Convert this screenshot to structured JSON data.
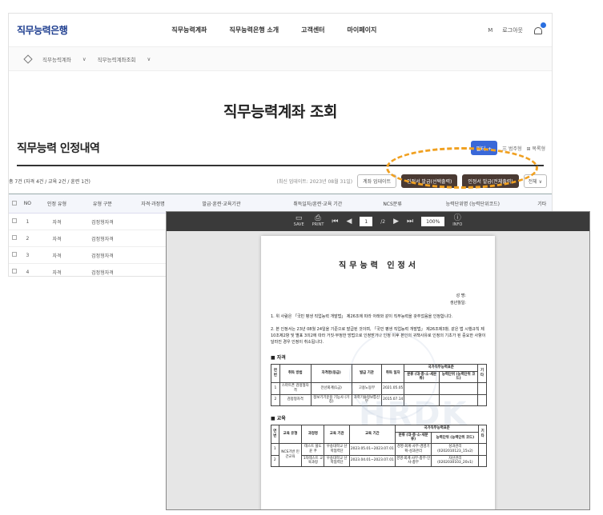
{
  "site": {
    "logo": "직무능력은행",
    "menu": [
      "직무능력계좌",
      "직무능력은행 소개",
      "고객센터",
      "마이페이지"
    ],
    "util": {
      "login": "로그아웃",
      "user_mark": "M"
    },
    "breadcrumb": [
      "직무능력계좌",
      "직무능력계좌조회"
    ],
    "page_title": "직무능력계좌 조회",
    "section_title": "직무능력 인정내역",
    "filter_button": "필터 +",
    "view_options": [
      "三 범주형",
      "⊞ 목록형"
    ],
    "total_text": "총 7건 (자격 4건 / 교육 2건 / 훈련 1건)",
    "update_text": "(최신 업데이트: 2023년 08월 31일)",
    "buttons": {
      "update": "계좌 업데이트",
      "issue_selected": "인정서 발급(선택출력)",
      "issue_all": "인정서 발급(전체출력)",
      "all_select": "전체 ∨"
    },
    "table": {
      "headers": [
        "",
        "NO",
        "인정 유형",
        "유형 구분",
        "자격·과정명",
        "발급·훈련·교육기관",
        "취득일자/훈련·교육 기간",
        "NCS분류",
        "능력단위명 (능력단위코드)",
        "기타"
      ],
      "rows": [
        [
          "",
          "1",
          "자격",
          "검정형자격"
        ],
        [
          "",
          "2",
          "자격",
          "검정형자격"
        ],
        [
          "",
          "3",
          "자격",
          "검정형자격"
        ],
        [
          "",
          "4",
          "자격",
          "검정형자격"
        ]
      ]
    }
  },
  "viewer": {
    "save": "SAVE",
    "print": "PRINT",
    "page_current": "1",
    "page_total": "/2",
    "zoom": "100%",
    "info": "INFO"
  },
  "doc": {
    "title": "직무능력 인정서",
    "name_label": "성    명:",
    "birth_label": "생년월일:",
    "para1": "1. 위 사람은 「국민 평생 직업능력 개발법」 제26조에 따라 아래와 같이 직무능력을 갖추었음을 인정합니다.",
    "para2": "2. 본 인정서는 23년 08월 24일을 기준으로 발급된 것이며, 「국민 평생 직업능력 개발법」 제26조제3항, 같은 법 시행규칙 제10조제2항 및 별표 3의2에 따라 거짓·부정한 방법으로 인정받거나 인정 이후 본인의 귀책사유로 인정의 기초가 된 중요한 사항이 달라진 경우 인정이 취소됩니다.",
    "sec1": "■ 자격",
    "sec2": "■ 교육",
    "ncs_header": "국가직무능력표준",
    "quali": {
      "headers": [
        "연번",
        "취득 방법",
        "자격명(등급)",
        "발급 기관",
        "취득 일자",
        "분류 (대·중·소·세분류)",
        "능력단위 (능력단위 코드)",
        "기타"
      ],
      "rows": [
        [
          "1",
          "스마트폰 검정형자격",
          "전산회계(1급)",
          "고용노동부",
          "2021.05.05",
          "",
          "",
          ""
        ],
        [
          "2",
          "검정형자격",
          "정보기기운용 기능사 (가칭)",
          "과학기술정보통신부",
          "2015.07.14",
          "",
          "",
          ""
        ]
      ]
    },
    "edu": {
      "headers": [
        "연번",
        "교육 유형",
        "과정명",
        "교육 기관",
        "교육 기간",
        "분류 (대·중·소·세분류)",
        "능력단위 (능력단위 코드)",
        "기타"
      ],
      "rows": [
        [
          "1",
          "NCS기반 민간교육",
          "테스트 블도윤 쿠",
          "우송대학교 산학협력단",
          "2023.05.01~2023.07.01",
          "경영·회계·사무-경영기획-성과관리",
          "성과관리 (0202010123_15v2)",
          ""
        ],
        [
          "2",
          "",
          "1차테스트 교육과정",
          "우송대학교 산학협력단",
          "2023.04.01~2023.07.01",
          "경영·회계·사무-총무·인사-총무",
          "자산관리 (0202030103_20v1)",
          ""
        ]
      ]
    },
    "watermark": "HRDK"
  }
}
